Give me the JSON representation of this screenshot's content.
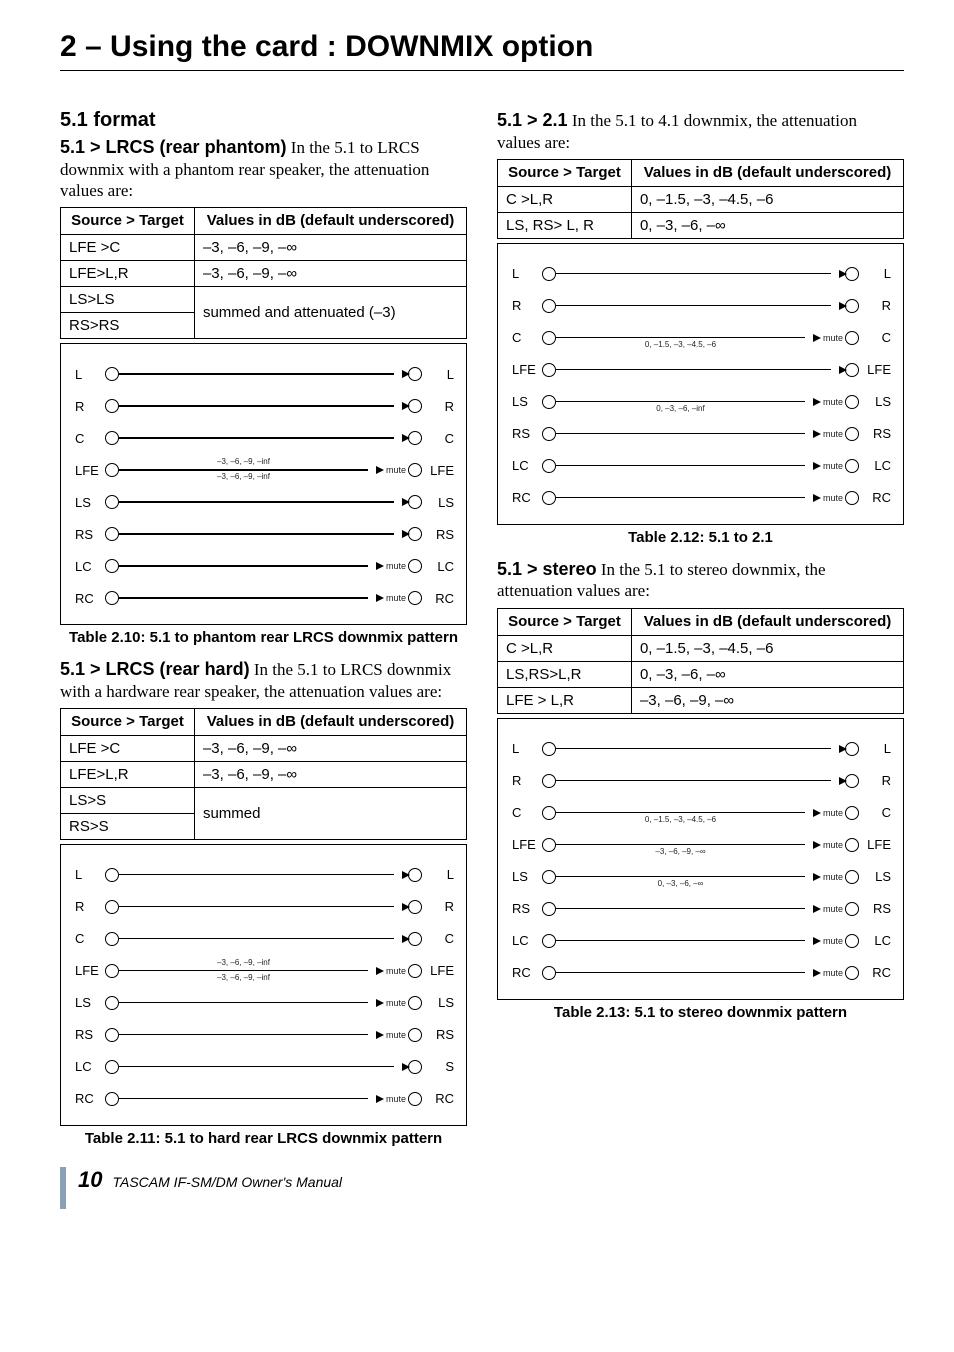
{
  "page_title": "2 – Using the card : DOWNMIX option",
  "sec51": "5.1 format",
  "th_src": "Source > Target",
  "th_val": "Values in dB (default underscored)",
  "s_lrcs_ph": {
    "lead": "5.1 > LRCS (rear phantom)",
    "trail": " In the 5.1 to LRCS downmix with a phantom rear speaker, the attenuation values are:",
    "rows": [
      [
        "LFE >C",
        "–3, –6, –9, –∞"
      ],
      [
        "LFE>L,R",
        "–3, –6, –9, –∞"
      ],
      [
        "LS>LS",
        ""
      ],
      [
        "RS>RS",
        ""
      ]
    ],
    "rowspan_val": "summed and attenuated (–3)",
    "caption": "Table 2.10: 5.1 to phantom rear LRCS downmix pattern",
    "diag_rows": [
      {
        "l": "L",
        "r": "L",
        "mute": false
      },
      {
        "l": "R",
        "r": "R",
        "mute": false
      },
      {
        "l": "C",
        "r": "C",
        "mute": false
      },
      {
        "l": "LFE",
        "r": "LFE",
        "mute": true,
        "ann": "–3, –6, –9, –inf",
        "ann2": "–3, –6, –9, –inf"
      },
      {
        "l": "LS",
        "r": "LS",
        "mute": false
      },
      {
        "l": "RS",
        "r": "RS",
        "mute": false
      },
      {
        "l": "LC",
        "r": "LC",
        "mute": true
      },
      {
        "l": "RC",
        "r": "RC",
        "mute": true
      }
    ]
  },
  "s_lrcs_hd": {
    "lead": "5.1 > LRCS (rear hard)",
    "trail": " In the 5.1 to LRCS downmix with a hardware rear speaker, the attenuation values are:",
    "rows": [
      [
        "LFE >C",
        "–3, –6, –9, –∞"
      ],
      [
        "LFE>L,R",
        "–3, –6, –9, –∞"
      ],
      [
        "LS>S",
        ""
      ],
      [
        "RS>S",
        ""
      ]
    ],
    "rowspan_val": "summed",
    "caption": "Table 2.11: 5.1 to hard rear LRCS downmix pattern",
    "diag_rows": [
      {
        "l": "L",
        "r": "L",
        "mute": false
      },
      {
        "l": "R",
        "r": "R",
        "mute": false
      },
      {
        "l": "C",
        "r": "C",
        "mute": false
      },
      {
        "l": "LFE",
        "r": "LFE",
        "mute": true,
        "ann": "–3, –6, –9, –inf",
        "ann2": "–3, –6, –9, –inf"
      },
      {
        "l": "LS",
        "r": "LS",
        "mute": true
      },
      {
        "l": "RS",
        "r": "RS",
        "mute": true
      },
      {
        "l": "LC",
        "r": "S",
        "mute": false
      },
      {
        "l": "RC",
        "r": "RC",
        "mute": true
      }
    ]
  },
  "s_21": {
    "lead": "5.1 > 2.1",
    "trail": " In the 5.1 to 4.1 downmix, the attenuation values are:",
    "rows": [
      [
        "C >L,R",
        "0, –1.5, –3, –4.5, –6"
      ],
      [
        "LS, RS> L, R",
        "0, –3, –6, –∞"
      ]
    ],
    "caption": "Table 2.12: 5.1 to 2.1",
    "diag_rows": [
      {
        "l": "L",
        "r": "L",
        "mute": false
      },
      {
        "l": "R",
        "r": "R",
        "mute": false
      },
      {
        "l": "C",
        "r": "C",
        "mute": true,
        "ann": "0, –1.5, –3, –4.5, –6"
      },
      {
        "l": "LFE",
        "r": "LFE",
        "mute": false
      },
      {
        "l": "LS",
        "r": "LS",
        "mute": true,
        "ann": "0, –3, –6, –inf"
      },
      {
        "l": "RS",
        "r": "RS",
        "mute": true
      },
      {
        "l": "LC",
        "r": "LC",
        "mute": true
      },
      {
        "l": "RC",
        "r": "RC",
        "mute": true
      }
    ]
  },
  "s_st": {
    "lead": "5.1 > stereo",
    "trail": " In the 5.1 to stereo downmix, the attenuation values are:",
    "rows": [
      [
        "C >L,R",
        "0, –1.5, –3, –4.5, –6"
      ],
      [
        "LS,RS>L,R",
        "0, –3, –6, –∞"
      ],
      [
        "LFE > L,R",
        "–3, –6, –9, –∞"
      ]
    ],
    "caption": "Table 2.13: 5.1 to stereo downmix pattern",
    "diag_rows": [
      {
        "l": "L",
        "r": "L",
        "mute": false
      },
      {
        "l": "R",
        "r": "R",
        "mute": false
      },
      {
        "l": "C",
        "r": "C",
        "mute": true,
        "ann": "0, –1.5, –3, –4.5, –6"
      },
      {
        "l": "LFE",
        "r": "LFE",
        "mute": true,
        "ann": "–3, –6, –9, –∞"
      },
      {
        "l": "LS",
        "r": "LS",
        "mute": true,
        "ann": "0, –3, –6, –∞"
      },
      {
        "l": "RS",
        "r": "RS",
        "mute": true
      },
      {
        "l": "LC",
        "r": "LC",
        "mute": true
      },
      {
        "l": "RC",
        "r": "RC",
        "mute": true
      }
    ]
  },
  "mute_label": "mute",
  "footer": {
    "page": "10",
    "text": "TASCAM IF-SM/DM Owner's Manual"
  }
}
